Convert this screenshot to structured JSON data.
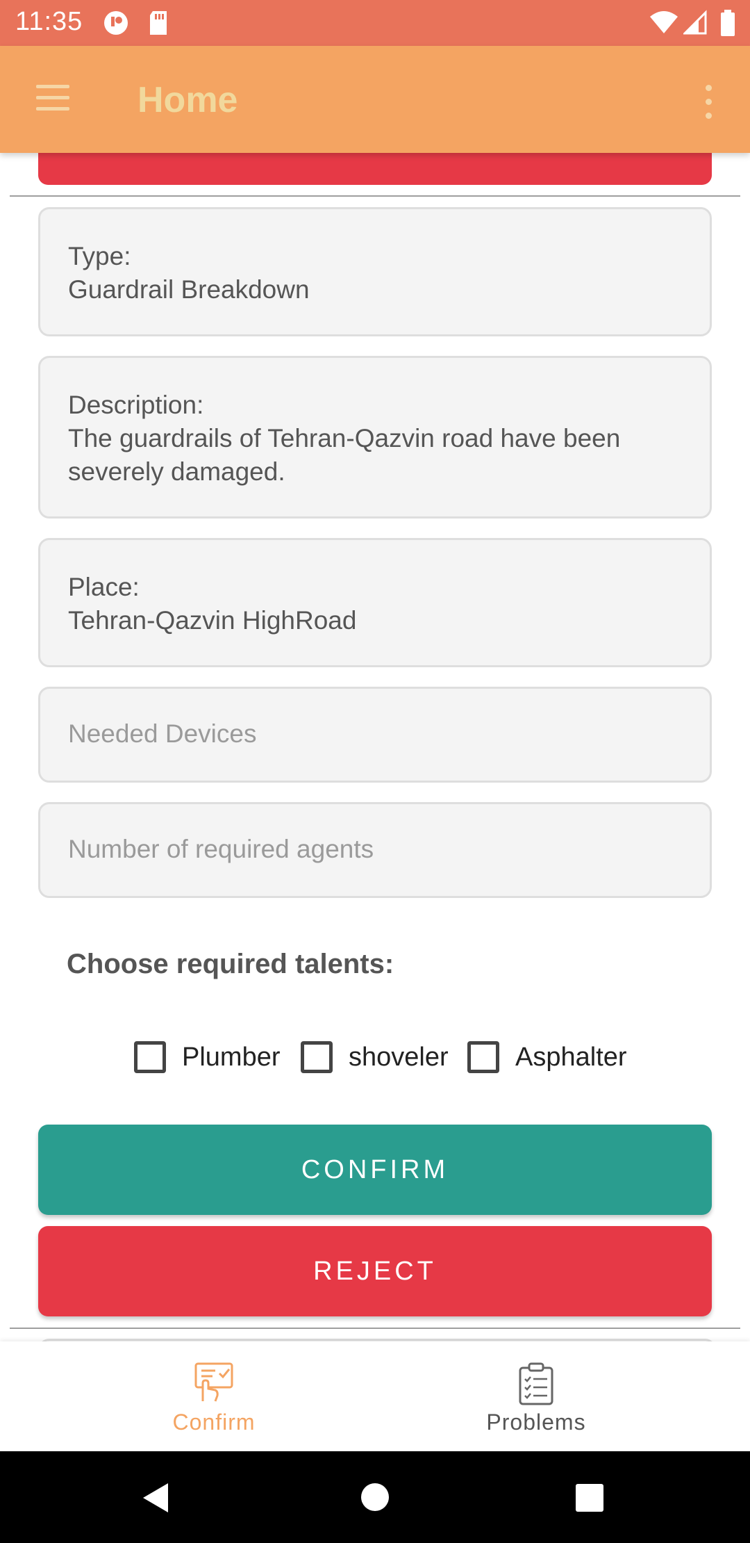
{
  "status_bar": {
    "time": "11:35"
  },
  "app_bar": {
    "title": "Home"
  },
  "fields": {
    "type_label": "Type:",
    "type_value": "Guardrail Breakdown",
    "description_label": "Description:",
    "description_value": "The guardrails of Tehran-Qazvin road have been severely damaged.",
    "place_label": "Place:",
    "place_value": "Tehran-Qazvin HighRoad",
    "devices_placeholder": "Needed Devices",
    "agents_placeholder": "Number of required agents"
  },
  "talents": {
    "title": "Choose required talents:",
    "options": [
      {
        "label": "Plumber",
        "checked": false
      },
      {
        "label": "shoveler",
        "checked": false
      },
      {
        "label": "Asphalter",
        "checked": false
      }
    ]
  },
  "actions": {
    "confirm": "CONFIRM",
    "reject": "REJECT"
  },
  "bottom_nav": {
    "items": [
      {
        "label": "Confirm",
        "icon": "confirm-icon",
        "active": true
      },
      {
        "label": "Problems",
        "icon": "clipboard-checklist-icon",
        "active": false
      }
    ]
  },
  "colors": {
    "status_bar": "#e8735a",
    "app_bar": "#f4a462",
    "title": "#f1d89c",
    "confirm": "#2a9d8f",
    "reject": "#e63946",
    "nav_active": "#f4a462",
    "nav_inactive": "#555555"
  }
}
